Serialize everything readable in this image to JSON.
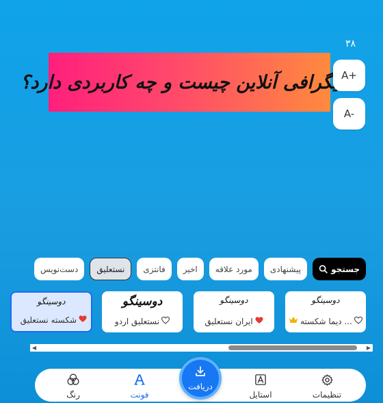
{
  "editor": {
    "size_value": "۳۸",
    "preview_text": "گالیگرافی آنلاین چیست و چه کاربردی دارد؟",
    "size_up_label": "A+",
    "size_down_label": "A-"
  },
  "filters": {
    "search_label": "جستجو",
    "chips": [
      {
        "label": "پیشنهادی"
      },
      {
        "label": "مورد علاقه"
      },
      {
        "label": "اخیر"
      },
      {
        "label": "فانتزی"
      },
      {
        "label": "نستعلیق",
        "active": true
      },
      {
        "label": "دست‌نویس"
      }
    ]
  },
  "fonts": [
    {
      "glyph": "دوسینگو",
      "name": "دیما شکسته ...",
      "favorite": false,
      "premium": true,
      "selected": false
    },
    {
      "glyph": "دوسینگو",
      "name": "ایران نستعلیق",
      "favorite": true,
      "premium": false,
      "selected": false
    },
    {
      "glyph": "دوسینگو",
      "name": "نستعلیق اردو",
      "favorite": false,
      "premium": false,
      "selected": false
    },
    {
      "glyph": "دوسینگو",
      "name": "شکسته نستعلیق",
      "favorite": true,
      "premium": false,
      "selected": true
    }
  ],
  "nav": {
    "settings_label": "تنظیمات",
    "style_label": "استایل",
    "download_label": "دریافت",
    "font_label": "فونت",
    "color_label": "رنگ"
  },
  "colors": {
    "accent": "#1877f2",
    "banner_start": "#ff1f7c",
    "banner_end": "#ff8a3d",
    "background": "#0fa3ea"
  }
}
